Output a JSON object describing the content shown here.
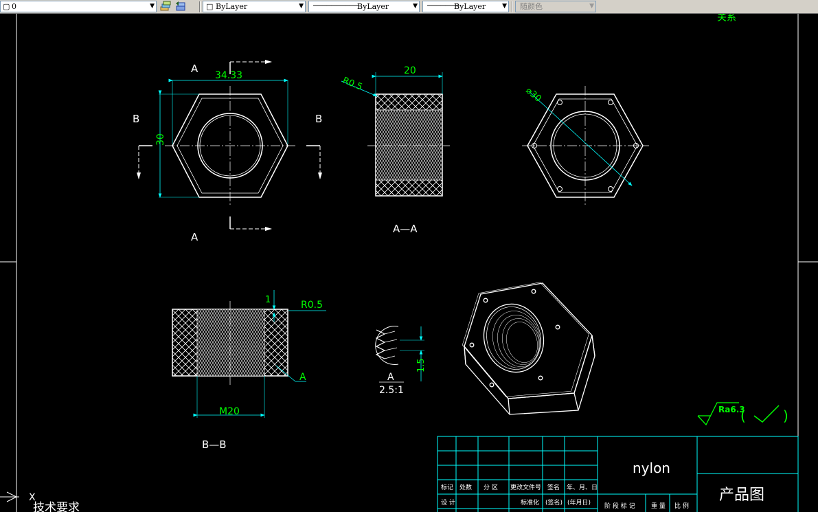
{
  "toolbar": {
    "layer_value": "0",
    "color_value": "ByLayer",
    "linetype_value": "ByLayer",
    "lineweight_value": "ByLayer",
    "plotstyle_value": "随颜色",
    "icons": [
      "layer-states-icon",
      "layer-previous-icon"
    ]
  },
  "drawing": {
    "top_corner_label": "关系",
    "view1": {
      "section_label_a_top": "A",
      "section_label_a_bottom": "A",
      "section_label_b_left": "B",
      "section_label_b_right": "B",
      "width_dim": "34.33",
      "height_dim": "30"
    },
    "view2": {
      "caption": "A—A",
      "width_dim": "20",
      "radius_dim": "R0.5"
    },
    "view3": {
      "diameter_dim": "⌀30"
    },
    "view4": {
      "caption": "B—B",
      "top_dim": "1",
      "radius_dim": "R0.5",
      "thread_dim": "M20",
      "detail_marker": "A"
    },
    "detail": {
      "label": "A",
      "scale": "2.5:1",
      "pitch_dim": "1.5"
    },
    "roughness": {
      "symbol_text": "Ra6.3",
      "paren_open": "(",
      "paren_close": ")"
    },
    "ucs": {
      "x_label": "X",
      "notes_title": "技术要求"
    }
  },
  "title_block": {
    "material": "nylon",
    "title": "产品图",
    "header_row1": [
      "标记",
      "处数",
      "分 区",
      "更改文件号",
      "签名",
      "年、月、日"
    ],
    "header_row2": [
      "设 计",
      "",
      "",
      "标准化",
      "(签名)",
      "(年月日)"
    ],
    "stage_row": [
      "阶 段 标 记",
      "重 量",
      "比 例"
    ]
  },
  "colors": {
    "background": "#000000",
    "lines": "#ffffff",
    "dimension": "#00ff00",
    "dimension_line": "#00ffff",
    "title_block": "#00ffff"
  }
}
